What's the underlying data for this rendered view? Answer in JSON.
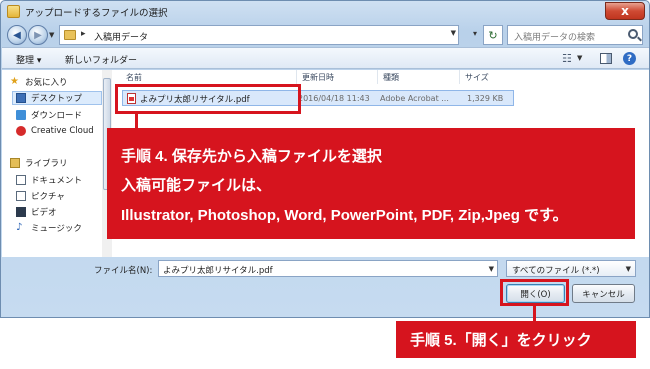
{
  "window": {
    "title": "アップロードするファイルの選択",
    "close_label": "x"
  },
  "address_bar": {
    "back_icon": "arrow-left-icon",
    "forward_icon": "arrow-right-icon",
    "path": "入稿用データ",
    "search_placeholder": "入稿用データの検索"
  },
  "toolbar": {
    "organize_label": "整理 ▾",
    "new_folder_label": "新しいフォルダー",
    "help_label": "?"
  },
  "sidebar": {
    "favorites_label": "お気に入り",
    "favorites": [
      "デスクトップ",
      "ダウンロード",
      "Creative Cloud"
    ],
    "libraries_label": "ライブラリ",
    "libraries": [
      "ドキュメント",
      "ピクチャ",
      "ビデオ",
      "ミュージック"
    ]
  },
  "file_list": {
    "columns": [
      "名前",
      "更新日時",
      "種類",
      "サイズ"
    ],
    "rows": [
      {
        "name": "よみプリ太郎リサイタル.pdf",
        "modified": "2016/04/18 11:43",
        "type": "Adobe Acrobat ...",
        "size": "1,329 KB"
      }
    ]
  },
  "footer": {
    "filename_label": "ファイル名(N):",
    "filename_value": "よみプリ太郎リサイタル.pdf",
    "filetype_value": "すべてのファイル (*.*)",
    "open_label": "開く(O)",
    "cancel_label": "キャンセル"
  },
  "callouts": {
    "step4_lines": [
      "手順 4. 保存先から入稿ファイルを選択",
      "入稿可能ファイルは、",
      "Illustrator, Photoshop, Word, PowerPoint, PDF, Zip,Jpeg です。"
    ],
    "step5": "手順 5.「開く」をクリック"
  },
  "colors": {
    "callout_red": "#d6141e",
    "selection_blue": "#d9e8fb",
    "frame_blue": "#b9d1ea"
  }
}
